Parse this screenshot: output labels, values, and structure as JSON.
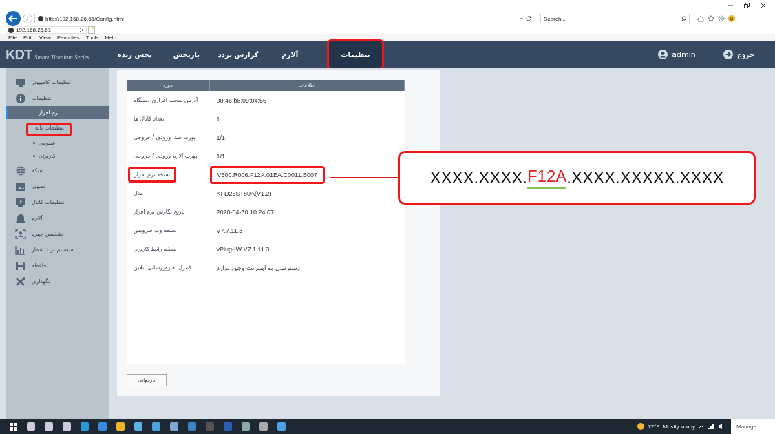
{
  "browser": {
    "address": "http://192.168.26.61/Config.html",
    "search": {
      "placeholder": "Search..."
    },
    "tab": "192.168.26.61",
    "menu": [
      "Help",
      "Tools",
      "Favorites",
      "View",
      "Edit",
      "File"
    ]
  },
  "navbar": {
    "logo": "KDT",
    "logo_subtitle": "Smart Titanium Series",
    "tabs": [
      {
        "label": "تنظیمات",
        "selected": true,
        "annotated": true
      },
      {
        "label": "آلارم",
        "selected": false,
        "annotated": false
      },
      {
        "label": "گزارش تردد",
        "selected": false,
        "annotated": false
      },
      {
        "label": "بازپخش",
        "selected": false,
        "annotated": false
      },
      {
        "label": "پخش زنده",
        "selected": false,
        "annotated": false
      }
    ],
    "user": "admin",
    "logout": "خروج"
  },
  "sidebar": {
    "items": [
      {
        "label": "تنظیمات کامپیوتر"
      },
      {
        "label": "تنظیمات",
        "children": [
          {
            "label": "نرم افزار",
            "selected": true,
            "annotated": false
          },
          {
            "label": "تنظیمات پایه",
            "selected": false,
            "annotated": true
          },
          {
            "label": "عمومی",
            "selected": false,
            "annotated": false
          },
          {
            "label": "کاربران",
            "selected": false,
            "annotated": false
          }
        ]
      },
      {
        "label": "شبکه"
      },
      {
        "label": "تصویر"
      },
      {
        "label": "تنظیمات کانال"
      },
      {
        "label": "آلارم"
      },
      {
        "label": "تشخیص چهره"
      },
      {
        "label": "سیستم تردد شمار"
      },
      {
        "label": "حافظه"
      },
      {
        "label": "نگهداری"
      }
    ]
  },
  "info_table": {
    "columns": [
      "مورد",
      "اطلاعات"
    ],
    "rows": [
      {
        "item": "آدرس سخت افزاری دستگاه",
        "value": "00:46:b8:09:04:56",
        "annotated": false
      },
      {
        "item": "تعداد کانال ها",
        "value": "1",
        "annotated": false
      },
      {
        "item": "پورت صدا ورودی / خروجی",
        "value": "1/1",
        "annotated": false
      },
      {
        "item": "پورت آلارم ورودی / خروجی",
        "value": "1/1",
        "annotated": false
      },
      {
        "item": "نسخه نرم افزار",
        "value": "V500.R006.F12A.01EA.C0011.B007",
        "annotated": true
      },
      {
        "item": "مدل",
        "value": "KI-D25ST80A(V1.2)",
        "annotated": false
      },
      {
        "item": "تاریخ نگارش نرم افزار",
        "value": "2020-04-30 10:24:07",
        "annotated": false
      },
      {
        "item": "نسخه وب سرویس",
        "value": "V7.7.11.3",
        "annotated": false
      },
      {
        "item": "نسخه رابط کاربری",
        "value": "vPlug-IW V7.1.11.3",
        "annotated": false
      },
      {
        "item": "کنترل به روزرسانی آنلاین",
        "value": "دسترسی به اینترنت وجود ندارد",
        "annotated": false
      }
    ]
  },
  "refresh_button": "بازخوانی",
  "callout": {
    "before": "XXXX.XXXX.",
    "highlight": "F12A",
    "after": ".XXXX.XXXXX.XXXX"
  },
  "taskbar": {
    "weather": "72°F",
    "weather_text": "Mostly sunny",
    "notification": "Manage"
  }
}
